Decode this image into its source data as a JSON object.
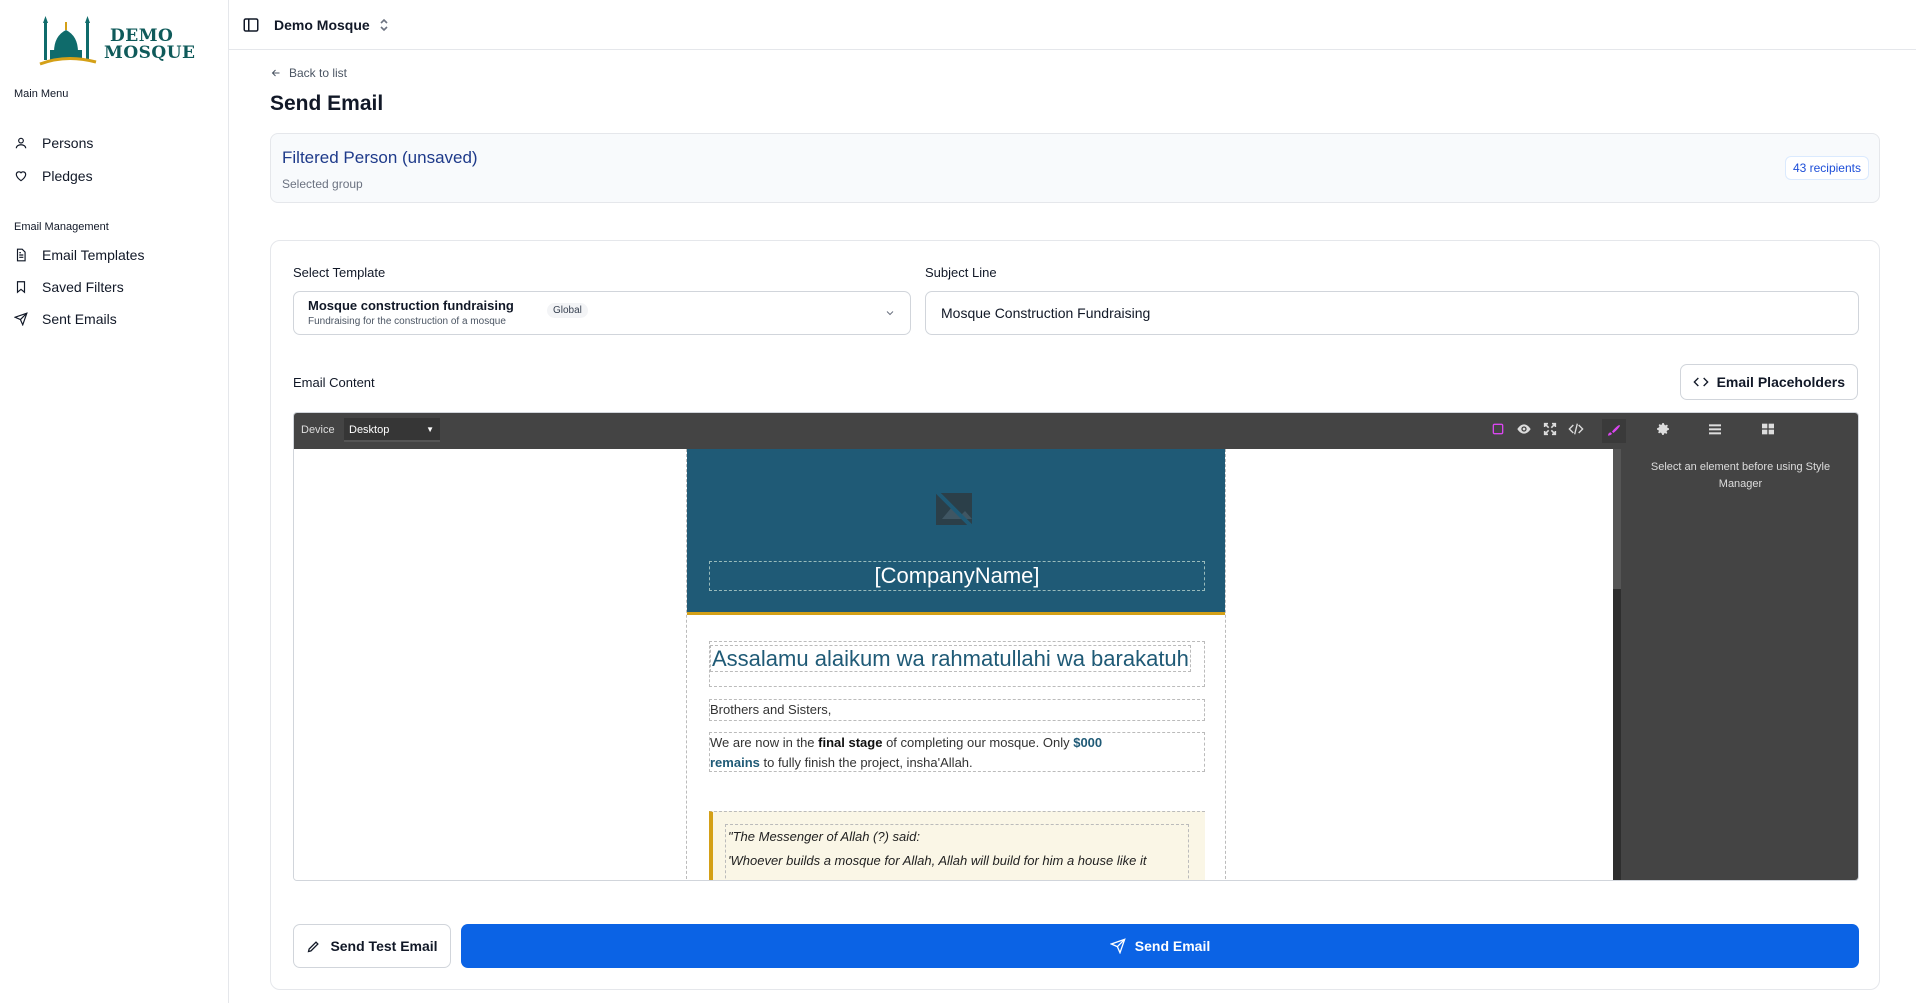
{
  "sidebar": {
    "logo_line1": "DEMO",
    "logo_line2": "MOSQUE",
    "main_menu_title": "Main Menu",
    "main_items": [
      {
        "label": "Persons",
        "icon": "user-icon"
      },
      {
        "label": "Pledges",
        "icon": "heart-icon"
      }
    ],
    "email_section_title": "Email Management",
    "email_items": [
      {
        "label": "Email Templates",
        "icon": "file-text-icon"
      },
      {
        "label": "Saved Filters",
        "icon": "bookmark-icon"
      },
      {
        "label": "Sent Emails",
        "icon": "send-icon"
      }
    ]
  },
  "topbar": {
    "org_name": "Demo Mosque"
  },
  "page": {
    "back_label": "Back to list",
    "title": "Send Email"
  },
  "group": {
    "title": "Filtered Person (unsaved)",
    "subtitle": "Selected group",
    "recipients": "43 recipients"
  },
  "form": {
    "template_label": "Select Template",
    "template_name": "Mosque construction fundraising",
    "template_desc": "Fundraising for the construction of a mosque",
    "template_badge": "Global",
    "subject_label": "Subject Line",
    "subject_value": "Mosque Construction Fundraising",
    "content_label": "Email Content",
    "placeholders_button": "Email Placeholders"
  },
  "editor": {
    "device_label": "Device",
    "device_value": "Desktop",
    "style_manager_hint": "Select an element before using Style Manager",
    "tools": [
      "border-toggle-icon",
      "eye-icon",
      "fullscreen-icon",
      "code-icon",
      "brush-icon",
      "gear-icon",
      "layers-icon",
      "blocks-icon"
    ],
    "colors": {
      "toolbar": "#444444",
      "active_tool": "#d946ef",
      "header_bg": "#1f5a76",
      "accent": "#d4a017"
    }
  },
  "email": {
    "company": "[CompanyName]",
    "greeting": "Assalamu alaikum wa rahmatullahi wa barakatuh",
    "salutation": "Brothers and Sisters,",
    "p1_a": "We are now in the ",
    "p1_b": "final stage",
    "p1_c": " of completing our mosque. Only ",
    "p1_d": "$000",
    "p1_e": "remains",
    "p1_f": " to fully finish the project, insha'Allah.",
    "quote_line1": "\"The Messenger of Allah (?) said:",
    "quote_line2": "'Whoever builds a mosque for Allah, Allah will build for him a house like it"
  },
  "actions": {
    "test_label": "Send Test Email",
    "send_label": "Send Email",
    "primary_color": "#0b63e5"
  }
}
